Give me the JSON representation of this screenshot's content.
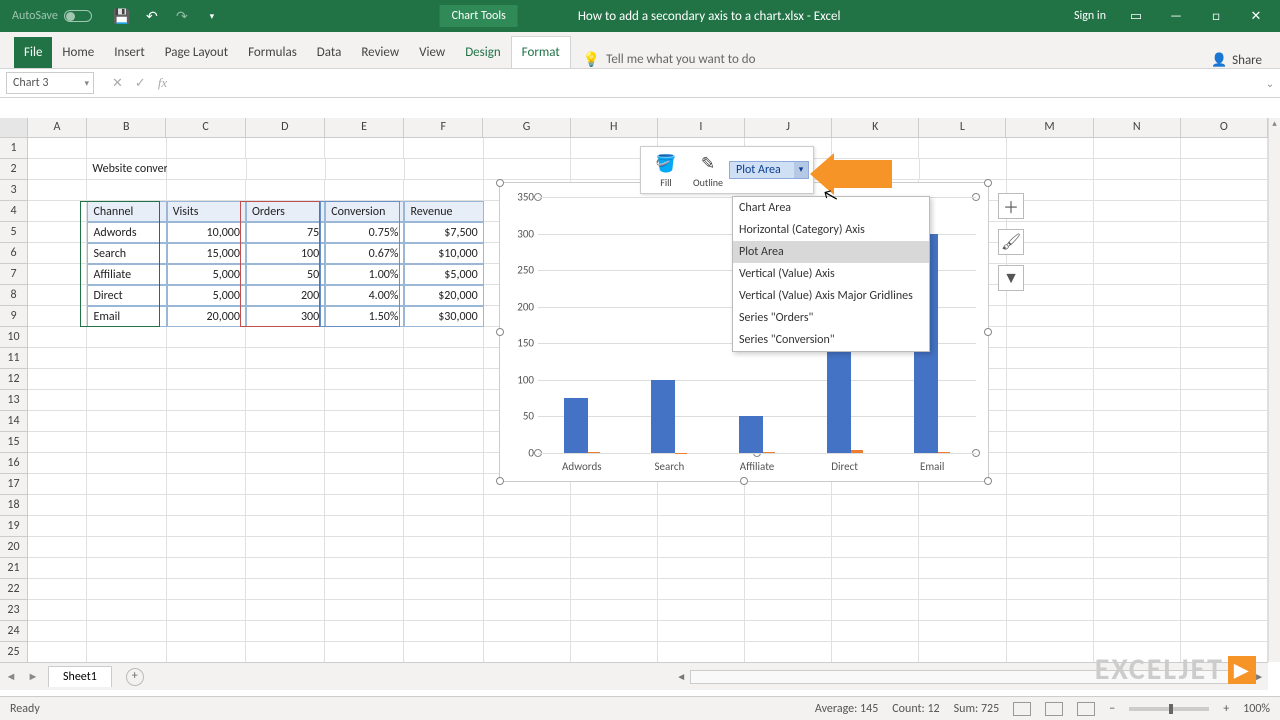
{
  "titlebar": {
    "autosave_label": "AutoSave",
    "doc_title": "How to add a secondary axis to a chart.xlsx  -  Excel",
    "chart_tools": "Chart Tools",
    "signin": "Sign in"
  },
  "tabs": [
    "File",
    "Home",
    "Insert",
    "Page Layout",
    "Formulas",
    "Data",
    "Review",
    "View",
    "Design",
    "Format"
  ],
  "active_tabs": [
    "Design",
    "Format"
  ],
  "tellme": "Tell me what you want to do",
  "share": "Share",
  "namebox": "Chart 3",
  "columns": [
    "A",
    "B",
    "C",
    "D",
    "E",
    "F",
    "G",
    "H",
    "I",
    "J",
    "K",
    "L",
    "M",
    "N",
    "O"
  ],
  "rows_visible": 25,
  "sheet_title": "Website conversion rates",
  "table": {
    "headers": [
      "Channel",
      "Visits",
      "Orders",
      "Conversion",
      "Revenue"
    ],
    "rows": [
      [
        "Adwords",
        "10,000",
        "75",
        "0.75%",
        "$7,500"
      ],
      [
        "Search",
        "15,000",
        "100",
        "0.67%",
        "$10,000"
      ],
      [
        "Affiliate",
        "5,000",
        "50",
        "1.00%",
        "$5,000"
      ],
      [
        "Direct",
        "5,000",
        "200",
        "4.00%",
        "$20,000"
      ],
      [
        "Email",
        "20,000",
        "300",
        "1.50%",
        "$30,000"
      ]
    ]
  },
  "mini_toolbar": {
    "fill": "Fill",
    "outline": "Outline",
    "selector_value": "Plot Area"
  },
  "dropdown": {
    "items": [
      "Chart Area",
      "Horizontal (Category) Axis",
      "Plot Area",
      "Vertical (Value) Axis",
      "Vertical (Value) Axis Major Gridlines",
      "Series \"Orders\"",
      "Series \"Conversion\""
    ],
    "highlighted": "Plot Area"
  },
  "chart_data": {
    "type": "bar",
    "categories": [
      "Adwords",
      "Search",
      "Affiliate",
      "Direct",
      "Email"
    ],
    "series": [
      {
        "name": "Orders",
        "values": [
          75,
          100,
          50,
          200,
          300
        ]
      },
      {
        "name": "Conversion",
        "values": [
          0.75,
          0.67,
          1.0,
          4.0,
          1.5
        ]
      }
    ],
    "ylabel": "",
    "yticks": [
      0,
      50,
      100,
      150,
      200,
      250,
      300,
      350
    ],
    "ylim": [
      0,
      350
    ]
  },
  "sheet_tab": "Sheet1",
  "status": {
    "ready": "Ready",
    "average": "Average: 145",
    "count": "Count: 12",
    "sum": "Sum: 725",
    "zoom": "100%"
  },
  "watermark": "EXCELJET"
}
